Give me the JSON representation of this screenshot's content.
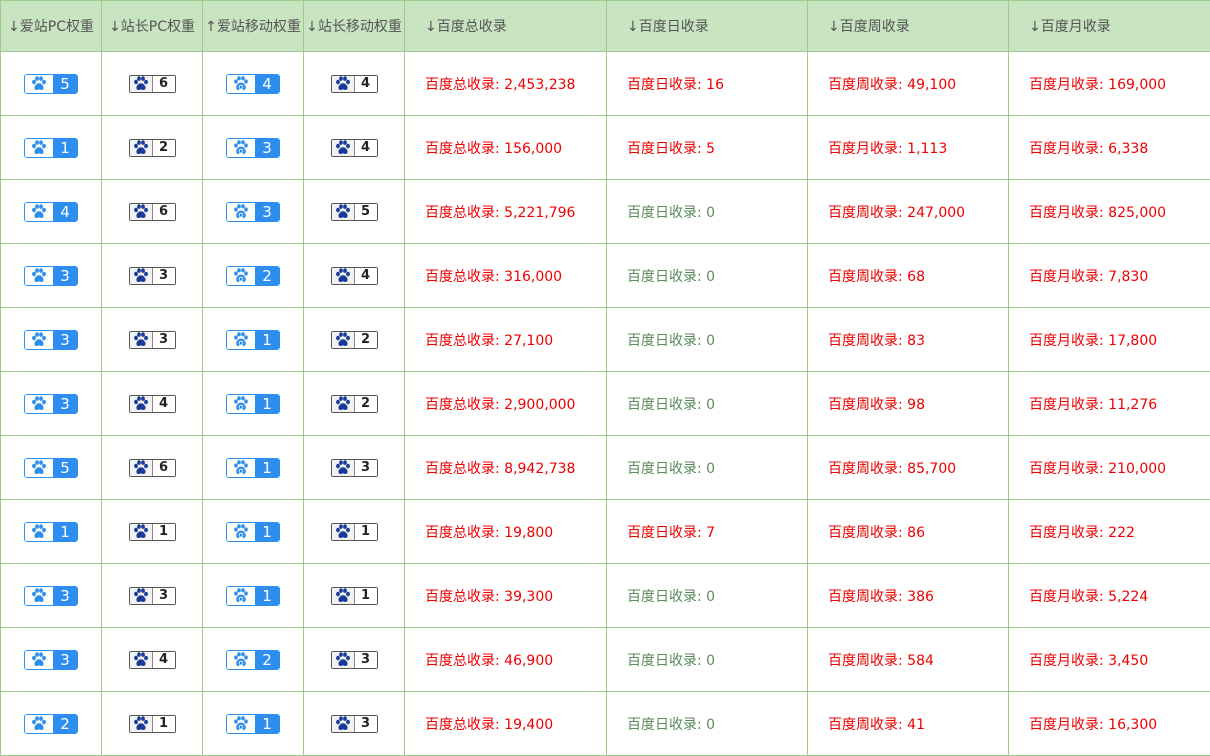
{
  "headers": {
    "aizhan_pc": "↓爱站PC权重",
    "zhanzhang_pc": "↓站长PC权重",
    "aizhan_mobile": "↑爱站移动权重",
    "zhanzhang_mobile": "↓站长移动权重",
    "baidu_total": "↓百度总收录",
    "baidu_day": "↓百度日收录",
    "baidu_week": "↓百度周收录",
    "baidu_month": "↓百度月收录"
  },
  "icons": {
    "aizhan_pc": "paw-icon",
    "zhanzhang": "paw-icon",
    "aizhan_mobile": "mobile-paw-icon"
  },
  "colors": {
    "header_bg": "#c8e4c0",
    "border": "#9ccc8c",
    "badge_blue": "#2e8ef0",
    "badge_gray_border": "#555555",
    "value_red": "#ee0000",
    "value_green": "#5a8a5a"
  },
  "rows": [
    {
      "az_pc": "5",
      "zz_pc": "6",
      "az_m": "4",
      "zz_m": "4",
      "total": "百度总收录: 2,453,238",
      "day": "百度日收录: 16",
      "day_zero": false,
      "week": "百度周收录: 49,100",
      "month": "百度月收录: 169,000"
    },
    {
      "az_pc": "1",
      "zz_pc": "2",
      "az_m": "3",
      "zz_m": "4",
      "total": "百度总收录: 156,000",
      "day": "百度日收录: 5",
      "day_zero": false,
      "week": "百度月收录: 1,113",
      "month": "百度月收录: 6,338"
    },
    {
      "az_pc": "4",
      "zz_pc": "6",
      "az_m": "3",
      "zz_m": "5",
      "total": "百度总收录: 5,221,796",
      "day": "百度日收录: 0",
      "day_zero": true,
      "week": "百度周收录: 247,000",
      "month": "百度月收录: 825,000"
    },
    {
      "az_pc": "3",
      "zz_pc": "3",
      "az_m": "2",
      "zz_m": "4",
      "total": "百度总收录: 316,000",
      "day": "百度日收录: 0",
      "day_zero": true,
      "week": "百度周收录: 68",
      "month": "百度月收录: 7,830"
    },
    {
      "az_pc": "3",
      "zz_pc": "3",
      "az_m": "1",
      "zz_m": "2",
      "total": "百度总收录: 27,100",
      "day": "百度日收录: 0",
      "day_zero": true,
      "week": "百度周收录: 83",
      "month": "百度月收录: 17,800"
    },
    {
      "az_pc": "3",
      "zz_pc": "4",
      "az_m": "1",
      "zz_m": "2",
      "total": "百度总收录: 2,900,000",
      "day": "百度日收录: 0",
      "day_zero": true,
      "week": "百度周收录: 98",
      "month": "百度月收录: 11,276"
    },
    {
      "az_pc": "5",
      "zz_pc": "6",
      "az_m": "1",
      "zz_m": "3",
      "total": "百度总收录: 8,942,738",
      "day": "百度日收录: 0",
      "day_zero": true,
      "week": "百度周收录: 85,700",
      "month": "百度月收录: 210,000"
    },
    {
      "az_pc": "1",
      "zz_pc": "1",
      "az_m": "1",
      "zz_m": "1",
      "total": "百度总收录: 19,800",
      "day": "百度日收录: 7",
      "day_zero": false,
      "week": "百度周收录: 86",
      "month": "百度月收录: 222"
    },
    {
      "az_pc": "3",
      "zz_pc": "3",
      "az_m": "1",
      "zz_m": "1",
      "total": "百度总收录: 39,300",
      "day": "百度日收录: 0",
      "day_zero": true,
      "week": "百度周收录: 386",
      "month": "百度月收录: 5,224"
    },
    {
      "az_pc": "3",
      "zz_pc": "4",
      "az_m": "2",
      "zz_m": "3",
      "total": "百度总收录: 46,900",
      "day": "百度日收录: 0",
      "day_zero": true,
      "week": "百度周收录: 584",
      "month": "百度月收录: 3,450"
    },
    {
      "az_pc": "2",
      "zz_pc": "1",
      "az_m": "1",
      "zz_m": "3",
      "total": "百度总收录: 19,400",
      "day": "百度日收录: 0",
      "day_zero": true,
      "week": "百度周收录: 41",
      "month": "百度月收录: 16,300"
    }
  ]
}
